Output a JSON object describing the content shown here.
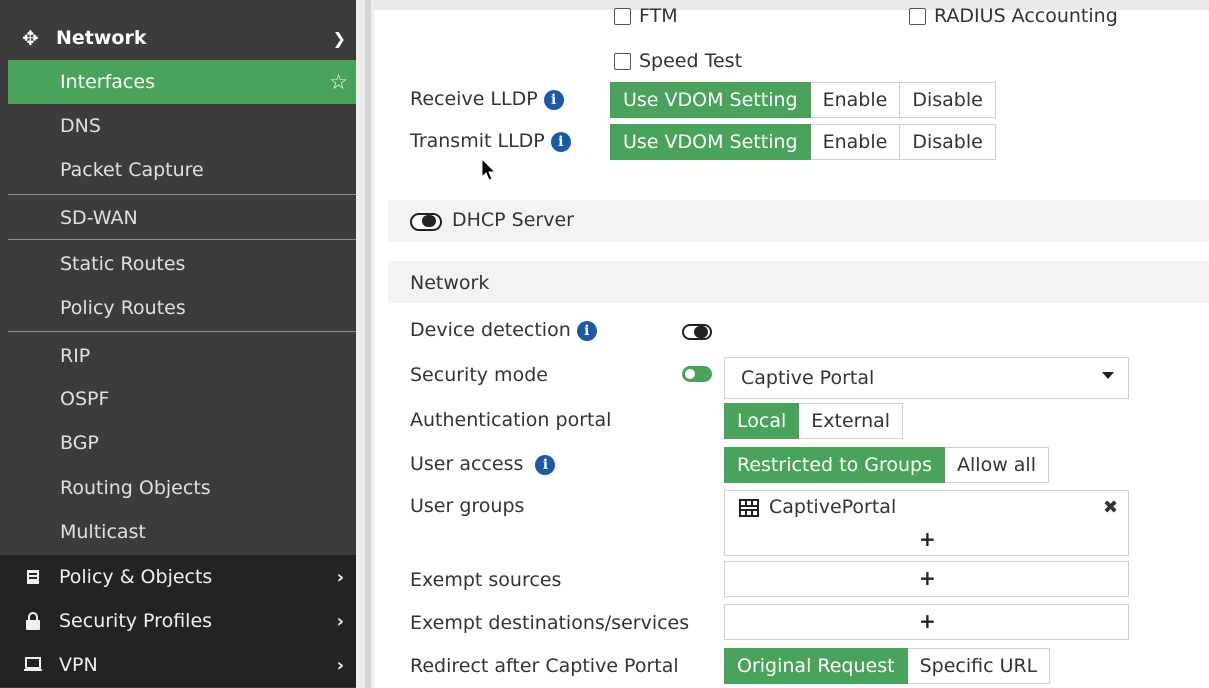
{
  "sidebar": {
    "network": {
      "label": "Network",
      "icon": "move-arrows-icon"
    },
    "items": [
      {
        "label": "Interfaces",
        "active": true
      },
      {
        "label": "DNS"
      },
      {
        "label": "Packet Capture"
      },
      {
        "label": "SD-WAN"
      },
      {
        "label": "Static Routes"
      },
      {
        "label": "Policy Routes"
      },
      {
        "label": "RIP"
      },
      {
        "label": "OSPF"
      },
      {
        "label": "BGP"
      },
      {
        "label": "Routing Objects"
      },
      {
        "label": "Multicast"
      }
    ],
    "top_items": [
      {
        "label": "Policy & Objects",
        "icon": "clipboard-icon"
      },
      {
        "label": "Security Profiles",
        "icon": "lock-icon"
      },
      {
        "label": "VPN",
        "icon": "monitor-icon"
      }
    ]
  },
  "main": {
    "checkboxes": {
      "ftm": "FTM",
      "radius": "RADIUS Accounting",
      "speed_test": "Speed Test"
    },
    "lldp": {
      "receive_label": "Receive LLDP",
      "transmit_label": "Transmit LLDP",
      "options": [
        "Use VDOM Setting",
        "Enable",
        "Disable"
      ]
    },
    "dhcp_server": "DHCP Server",
    "network_section": "Network",
    "device_detection": "Device detection",
    "security_mode": {
      "label": "Security mode",
      "value": "Captive Portal"
    },
    "auth_portal": {
      "label": "Authentication portal",
      "options": [
        "Local",
        "External"
      ]
    },
    "user_access": {
      "label": "User access",
      "options": [
        "Restricted to Groups",
        "Allow all"
      ]
    },
    "user_groups": {
      "label": "User groups",
      "group": "CaptivePortal"
    },
    "exempt_sources": "Exempt sources",
    "exempt_destinations": "Exempt destinations/services",
    "redirect": {
      "label": "Redirect after Captive Portal",
      "options": [
        "Original Request",
        "Specific URL"
      ]
    },
    "plus_symbol": "+",
    "remove_symbol": "✖"
  },
  "colors": {
    "accent": "#4aa35a",
    "sidebar_bg": "#3a3d3c",
    "sidebar_top_bg": "#222423",
    "info_icon": "#1a5aa8"
  }
}
